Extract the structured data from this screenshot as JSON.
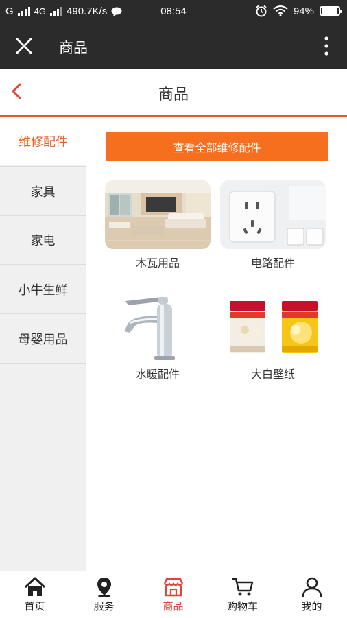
{
  "status_bar": {
    "carrier1": "G",
    "carrier2": "4G",
    "speed": "490.7K/s",
    "time": "08:54",
    "battery": "94%",
    "battery_level": 0.94
  },
  "app_bar": {
    "title": "商品"
  },
  "title_bar": {
    "title": "商品"
  },
  "sidebar": {
    "items": [
      {
        "label": "维修配件",
        "active": true
      },
      {
        "label": "家具"
      },
      {
        "label": "家电"
      },
      {
        "label": "小牛生鲜"
      },
      {
        "label": "母婴用品"
      }
    ]
  },
  "content": {
    "view_all_label": "查看全部维修配件",
    "products": [
      {
        "label": "木瓦用品",
        "icon": "living-room-image"
      },
      {
        "label": "电路配件",
        "icon": "wall-socket-image"
      },
      {
        "label": "水暖配件",
        "icon": "faucet-image"
      },
      {
        "label": "大白壁纸",
        "icon": "paint-bucket-image"
      }
    ]
  },
  "tab_bar": {
    "items": [
      {
        "label": "首页",
        "icon": "home-icon"
      },
      {
        "label": "服务",
        "icon": "location-pin-icon"
      },
      {
        "label": "商品",
        "icon": "store-icon",
        "active": true
      },
      {
        "label": "购物车",
        "icon": "cart-icon"
      },
      {
        "label": "我的",
        "icon": "user-icon"
      }
    ]
  },
  "colors": {
    "accent": "#e55a2b",
    "button": "#f56f1f",
    "active_tab": "#e0433a",
    "dark_bar": "#2b2b2b"
  }
}
